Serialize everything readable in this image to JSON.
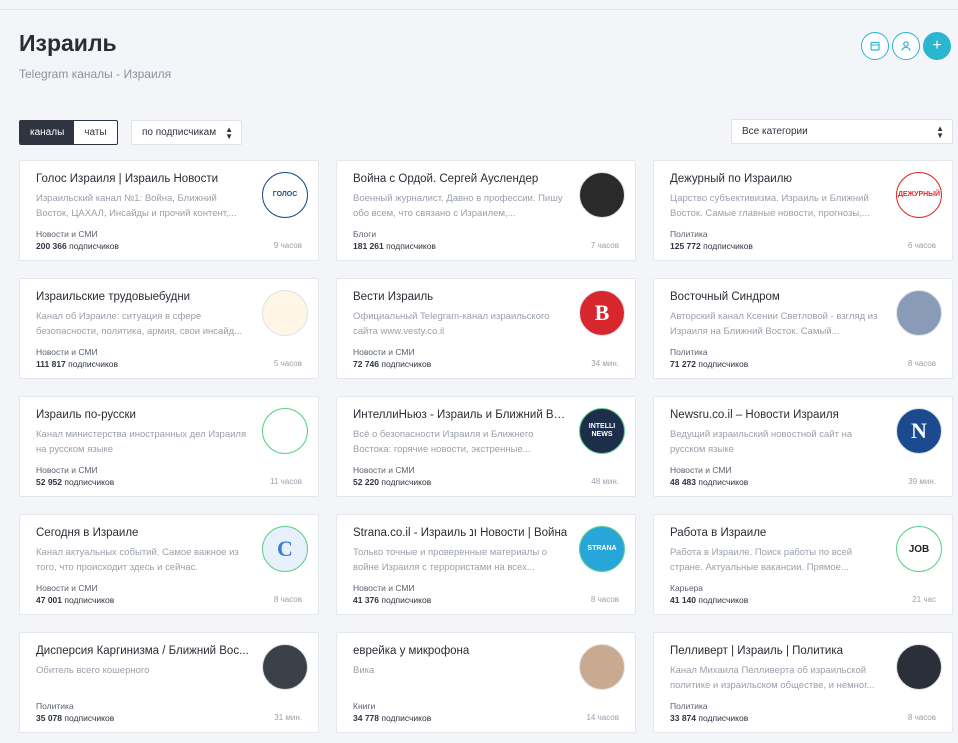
{
  "page": {
    "title": "Израиль",
    "subtitle": "Telegram каналы - Израиля"
  },
  "controls": {
    "tabs": [
      {
        "label": "каналы",
        "active": true
      },
      {
        "label": "чаты",
        "active": false
      }
    ],
    "sort": {
      "value": "по подписчикам"
    },
    "category": {
      "value": "Все категории"
    },
    "actions": [
      {
        "icon": "calendar-icon"
      },
      {
        "icon": "user-icon"
      },
      {
        "icon": "plus-icon",
        "label": "+"
      }
    ]
  },
  "subs_suffix": "подписчиков",
  "channels": [
    {
      "title": "Голос Израиля | Израиль Новости",
      "desc": "Израильский канал №1: Война, Ближний Восток, ЦАХАЛ, Инсайды и прочий контент,...",
      "category": "Новости и СМИ",
      "subs": "200 366",
      "time": "9 часов",
      "avatar": {
        "text": "ГОЛОС",
        "bg": "#ffffff",
        "fg": "#1c4c8c",
        "ring": "#1c4c8c"
      }
    },
    {
      "title": "Война с Ордой. Сергей Ауслендер",
      "desc": "Военный журналист. Давно в профессии. Пишу обо всем, что связано с Израилем,...",
      "category": "Блоги",
      "subs": "181 261",
      "time": "7 часов",
      "avatar": {
        "text": "",
        "bg": "#2a2a2a",
        "fg": "#ffffff",
        "ring": "#dfe3e8"
      }
    },
    {
      "title": "Дежурный по Израилю",
      "desc": "Царство субъективизма. Израиль и Ближний Восток. Самые главные новости, прогнозы,...",
      "category": "Политика",
      "subs": "125 772",
      "time": "6 часов",
      "avatar": {
        "text": "ДЕЖУРНЫЙ",
        "bg": "#ffffff",
        "fg": "#e02b2b",
        "ring": "#e02b2b"
      }
    },
    {
      "title": "Израильские трудовыебудни",
      "desc": "Канал об Израиле: ситуация в сфере безопасности, политика, армия, свои инсайд...",
      "category": "Новости и СМИ",
      "subs": "111 817",
      "time": "5 часов",
      "avatar": {
        "text": "",
        "bg": "#fff6e6",
        "fg": "#e07a1c",
        "ring": "#dfe3e8"
      }
    },
    {
      "title": "Вести Израиль",
      "desc": "Официальный Telegram-канал израильского сайта www.vesty.co.il",
      "category": "Новости и СМИ",
      "subs": "72 746",
      "time": "34 мин.",
      "avatar": {
        "text": "В",
        "bg": "#d7262c",
        "fg": "#ffffff",
        "ring": "#dfe3e8"
      }
    },
    {
      "title": "Восточный Синдром",
      "desc": "Авторский канал Ксении Светловой - взгляд из Израиля на Ближний Восток. Самый...",
      "category": "Политика",
      "subs": "71 272",
      "time": "8 часов",
      "avatar": {
        "text": "",
        "bg": "#8a9bb8",
        "fg": "#ffffff",
        "ring": "#dfe3e8"
      }
    },
    {
      "title": "Израиль по-русски",
      "desc": "Канал министерства иностранных дел Израиля на русском языке",
      "category": "Новости и СМИ",
      "subs": "52 952",
      "time": "11 часов",
      "avatar": {
        "text": "",
        "bg": "#ffffff",
        "fg": "#1a5aa8",
        "ring": "#5ccf8a"
      }
    },
    {
      "title": "ИнтеллиНьюз - Израиль и Ближний Во...",
      "desc": "Всё о безопасности Израиля и Ближнего Востока: горячие новости, экстренные...",
      "category": "Новости и СМИ",
      "subs": "52 220",
      "time": "48 мин.",
      "avatar": {
        "text": "INTELLI NEWS",
        "bg": "#1e2e4a",
        "fg": "#ffffff",
        "ring": "#5ccf8a"
      }
    },
    {
      "title": "Newsru.co.il – Новости Израиля",
      "desc": "Ведущий израильский новостной сайт на русском языке",
      "category": "Новости и СМИ",
      "subs": "48 483",
      "time": "39 мин.",
      "avatar": {
        "text": "N",
        "bg": "#1b4a8f",
        "fg": "#ffffff",
        "ring": "#dfe3e8"
      }
    },
    {
      "title": "Сегодня в Израиле",
      "desc": "Канал актуальных событий. Самое важное из того, что происходит здесь и сейчас.",
      "category": "Новости и СМИ",
      "subs": "47 001",
      "time": "8 часов",
      "avatar": {
        "text": "С",
        "bg": "#e8f1fb",
        "fg": "#3a7fd5",
        "ring": "#5ccf8a"
      }
    },
    {
      "title": "Strana.co.il - Израиль ונ Новости | Война",
      "desc": "Только точные и проверенные материалы о войне Израиля с террористами на всех...",
      "category": "Новости и СМИ",
      "subs": "41 376",
      "time": "8 часов",
      "avatar": {
        "text": "STRANA",
        "bg": "#29a6d9",
        "fg": "#ffffff",
        "ring": "#5ccf8a"
      }
    },
    {
      "title": "Работа в Израиле",
      "desc": "Работа в Израиле. Поиск работы по всей стране. Актуальные вакансии. Прямое...",
      "category": "Карьера",
      "subs": "41 140",
      "time": "21 час",
      "avatar": {
        "text": "JOB",
        "bg": "#ffffff",
        "fg": "#222222",
        "ring": "#5ccf8a"
      }
    },
    {
      "title": "Дисперсия Каргинизма / Ближний Вос...",
      "desc": "Обитель всего кошерного",
      "category": "Политика",
      "subs": "35 078",
      "time": "31 мин.",
      "avatar": {
        "text": "",
        "bg": "#3b3f47",
        "fg": "#ffffff",
        "ring": "#dfe3e8"
      }
    },
    {
      "title": "еврейка у микрофона",
      "desc": "Вика",
      "category": "Книги",
      "subs": "34 778",
      "time": "14 часов",
      "avatar": {
        "text": "",
        "bg": "#c9a98f",
        "fg": "#ffffff",
        "ring": "#dfe3e8"
      }
    },
    {
      "title": "Пелливерт | Израиль | Политика",
      "desc": "Канал Михаила Пелливерта об израильской политике и израильском обществе, и немног...",
      "category": "Политика",
      "subs": "33 874",
      "time": "8 часов",
      "avatar": {
        "text": "",
        "bg": "#2b2f3a",
        "fg": "#ffffff",
        "ring": "#dfe3e8"
      }
    }
  ]
}
